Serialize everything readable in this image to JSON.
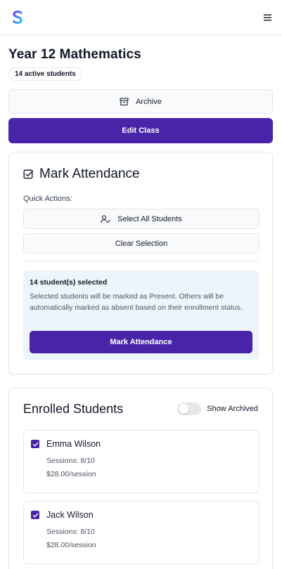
{
  "header": {
    "logo_icon": "brand-s-logo",
    "menu_icon": "hamburger-icon"
  },
  "class": {
    "title": "Year 12 Mathematics",
    "badge": "14 active students"
  },
  "actions": {
    "archive_label": "Archive",
    "archive_icon": "archive-box-icon",
    "edit_label": "Edit Class"
  },
  "attendance": {
    "title": "Mark Attendance",
    "title_icon": "checkbox-square-icon",
    "quick_actions_label": "Quick Actions:",
    "select_all_label": "Select All Students",
    "select_all_icon": "user-check-icon",
    "clear_label": "Clear Selection",
    "selected_count_text": "14 student(s) selected",
    "selected_description": "Selected students will be marked as Present. Others will be automatically marked as absent based on their enrollment status.",
    "mark_button_label": "Mark Attendance"
  },
  "enrolled": {
    "title": "Enrolled Students",
    "show_archived_label": "Show Archived",
    "show_archived_on": false,
    "students": [
      {
        "name": "Emma Wilson",
        "sessions": "Sessions: 8/10",
        "rate": "$28.00/session",
        "checked": true
      },
      {
        "name": "Jack Wilson",
        "sessions": "Sessions: 8/10",
        "rate": "$28.00/session",
        "checked": true
      }
    ]
  },
  "colors": {
    "primary": "#4a24a8",
    "selection_bg": "#eef4fc",
    "border": "#e5e7eb"
  }
}
